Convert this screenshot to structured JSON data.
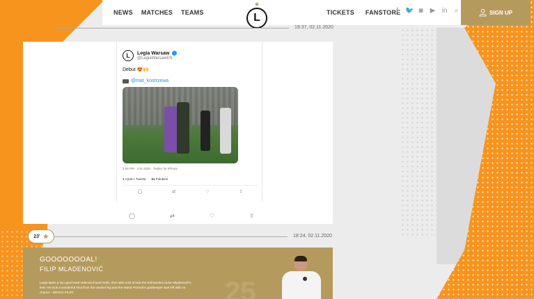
{
  "nav": {
    "left": [
      "NEWS",
      "MATCHES",
      "TEAMS"
    ],
    "right": [
      "TICKETS",
      "FANSTORE"
    ],
    "signup_label": "SIGN UP",
    "logo_letter": "L"
  },
  "social_icons": [
    "facebook-icon",
    "twitter-icon",
    "instagram-icon",
    "youtube-icon",
    "linkedin-icon",
    "search-icon"
  ],
  "timeline": {
    "first_time": "19:37, 02.11.2020",
    "second_time": "18:24, 02.11.2020"
  },
  "tweet": {
    "name": "Legia Warsaw",
    "handle": "@LegiaWarsawEN",
    "text": "Debut 😍🙌",
    "mention": "@mat_kostrzewa",
    "meta": "3:26 PM · 2 lis 2020 · Twitter for iPhone",
    "quote_count": "1",
    "quote_label": "Cytat z Tweeta",
    "likes_count": "51",
    "likes_label": "Polubień"
  },
  "minute_badge": {
    "minute": "23'"
  },
  "goal": {
    "headline": "GOOOOOOOAL!",
    "scorer": "FILIP MLADENOVIĆ",
    "text": "Legia takes a two-goal lead! Valencia found Gelis, then with a bit of luck the ball landed under Mladenović's feet. He took a wonderful shot from the weaker leg and the Warta Poznań's goalkeeper was left with no chance - BRAVO FILIP!",
    "number": "25"
  },
  "colors": {
    "accent_gold": "#b59a5d",
    "orange": "#f7941d",
    "twitter_blue": "#1da1f2"
  }
}
